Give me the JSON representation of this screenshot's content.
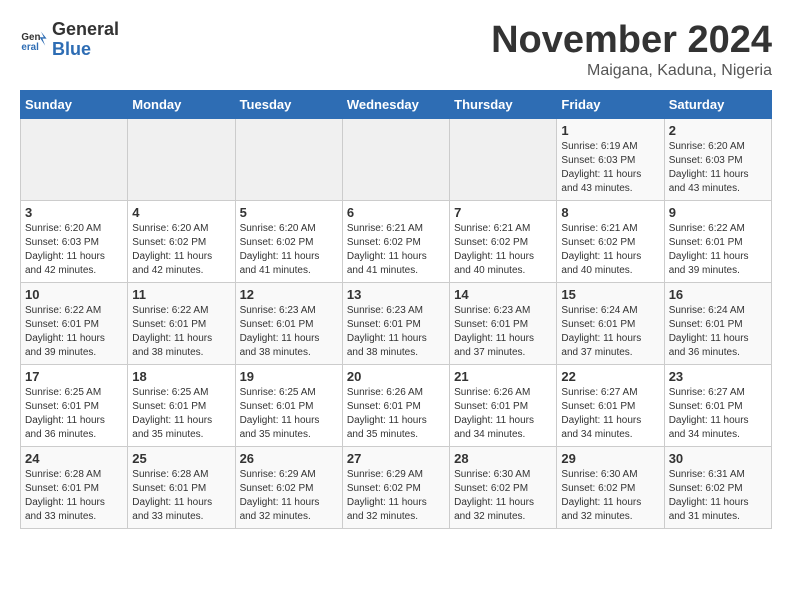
{
  "header": {
    "logo_general": "General",
    "logo_blue": "Blue",
    "month_title": "November 2024",
    "location": "Maigana, Kaduna, Nigeria"
  },
  "days_of_week": [
    "Sunday",
    "Monday",
    "Tuesday",
    "Wednesday",
    "Thursday",
    "Friday",
    "Saturday"
  ],
  "weeks": [
    [
      {
        "day": "",
        "info": ""
      },
      {
        "day": "",
        "info": ""
      },
      {
        "day": "",
        "info": ""
      },
      {
        "day": "",
        "info": ""
      },
      {
        "day": "",
        "info": ""
      },
      {
        "day": "1",
        "info": "Sunrise: 6:19 AM\nSunset: 6:03 PM\nDaylight: 11 hours\nand 43 minutes."
      },
      {
        "day": "2",
        "info": "Sunrise: 6:20 AM\nSunset: 6:03 PM\nDaylight: 11 hours\nand 43 minutes."
      }
    ],
    [
      {
        "day": "3",
        "info": "Sunrise: 6:20 AM\nSunset: 6:03 PM\nDaylight: 11 hours\nand 42 minutes."
      },
      {
        "day": "4",
        "info": "Sunrise: 6:20 AM\nSunset: 6:02 PM\nDaylight: 11 hours\nand 42 minutes."
      },
      {
        "day": "5",
        "info": "Sunrise: 6:20 AM\nSunset: 6:02 PM\nDaylight: 11 hours\nand 41 minutes."
      },
      {
        "day": "6",
        "info": "Sunrise: 6:21 AM\nSunset: 6:02 PM\nDaylight: 11 hours\nand 41 minutes."
      },
      {
        "day": "7",
        "info": "Sunrise: 6:21 AM\nSunset: 6:02 PM\nDaylight: 11 hours\nand 40 minutes."
      },
      {
        "day": "8",
        "info": "Sunrise: 6:21 AM\nSunset: 6:02 PM\nDaylight: 11 hours\nand 40 minutes."
      },
      {
        "day": "9",
        "info": "Sunrise: 6:22 AM\nSunset: 6:01 PM\nDaylight: 11 hours\nand 39 minutes."
      }
    ],
    [
      {
        "day": "10",
        "info": "Sunrise: 6:22 AM\nSunset: 6:01 PM\nDaylight: 11 hours\nand 39 minutes."
      },
      {
        "day": "11",
        "info": "Sunrise: 6:22 AM\nSunset: 6:01 PM\nDaylight: 11 hours\nand 38 minutes."
      },
      {
        "day": "12",
        "info": "Sunrise: 6:23 AM\nSunset: 6:01 PM\nDaylight: 11 hours\nand 38 minutes."
      },
      {
        "day": "13",
        "info": "Sunrise: 6:23 AM\nSunset: 6:01 PM\nDaylight: 11 hours\nand 38 minutes."
      },
      {
        "day": "14",
        "info": "Sunrise: 6:23 AM\nSunset: 6:01 PM\nDaylight: 11 hours\nand 37 minutes."
      },
      {
        "day": "15",
        "info": "Sunrise: 6:24 AM\nSunset: 6:01 PM\nDaylight: 11 hours\nand 37 minutes."
      },
      {
        "day": "16",
        "info": "Sunrise: 6:24 AM\nSunset: 6:01 PM\nDaylight: 11 hours\nand 36 minutes."
      }
    ],
    [
      {
        "day": "17",
        "info": "Sunrise: 6:25 AM\nSunset: 6:01 PM\nDaylight: 11 hours\nand 36 minutes."
      },
      {
        "day": "18",
        "info": "Sunrise: 6:25 AM\nSunset: 6:01 PM\nDaylight: 11 hours\nand 35 minutes."
      },
      {
        "day": "19",
        "info": "Sunrise: 6:25 AM\nSunset: 6:01 PM\nDaylight: 11 hours\nand 35 minutes."
      },
      {
        "day": "20",
        "info": "Sunrise: 6:26 AM\nSunset: 6:01 PM\nDaylight: 11 hours\nand 35 minutes."
      },
      {
        "day": "21",
        "info": "Sunrise: 6:26 AM\nSunset: 6:01 PM\nDaylight: 11 hours\nand 34 minutes."
      },
      {
        "day": "22",
        "info": "Sunrise: 6:27 AM\nSunset: 6:01 PM\nDaylight: 11 hours\nand 34 minutes."
      },
      {
        "day": "23",
        "info": "Sunrise: 6:27 AM\nSunset: 6:01 PM\nDaylight: 11 hours\nand 34 minutes."
      }
    ],
    [
      {
        "day": "24",
        "info": "Sunrise: 6:28 AM\nSunset: 6:01 PM\nDaylight: 11 hours\nand 33 minutes."
      },
      {
        "day": "25",
        "info": "Sunrise: 6:28 AM\nSunset: 6:01 PM\nDaylight: 11 hours\nand 33 minutes."
      },
      {
        "day": "26",
        "info": "Sunrise: 6:29 AM\nSunset: 6:02 PM\nDaylight: 11 hours\nand 32 minutes."
      },
      {
        "day": "27",
        "info": "Sunrise: 6:29 AM\nSunset: 6:02 PM\nDaylight: 11 hours\nand 32 minutes."
      },
      {
        "day": "28",
        "info": "Sunrise: 6:30 AM\nSunset: 6:02 PM\nDaylight: 11 hours\nand 32 minutes."
      },
      {
        "day": "29",
        "info": "Sunrise: 6:30 AM\nSunset: 6:02 PM\nDaylight: 11 hours\nand 32 minutes."
      },
      {
        "day": "30",
        "info": "Sunrise: 6:31 AM\nSunset: 6:02 PM\nDaylight: 11 hours\nand 31 minutes."
      }
    ]
  ]
}
